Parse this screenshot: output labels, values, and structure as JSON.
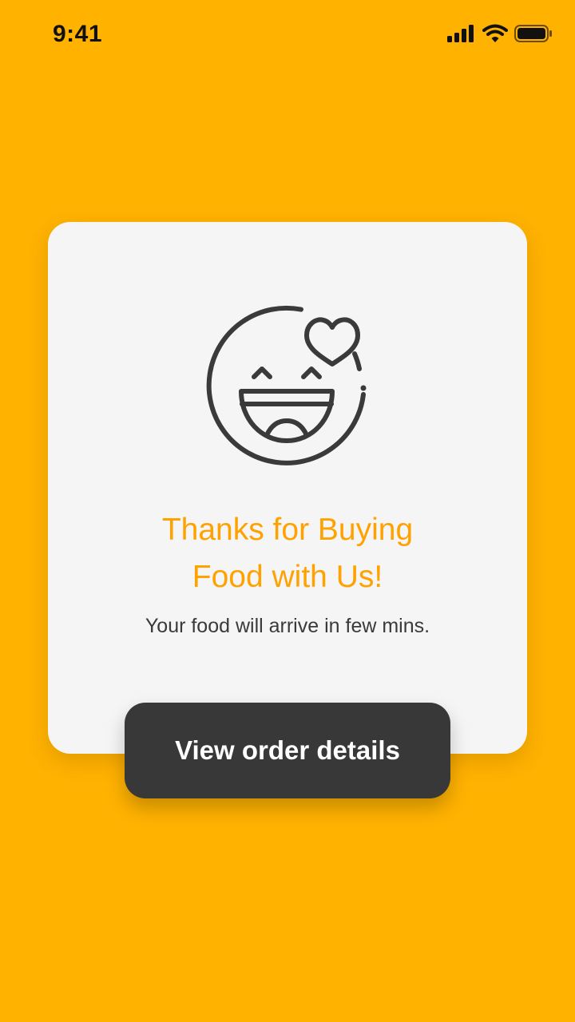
{
  "status_bar": {
    "time": "9:41",
    "icons": [
      "cellular-signal-icon",
      "wifi-icon",
      "battery-icon"
    ]
  },
  "confirmation": {
    "icon": "smiling-face-with-heart-icon",
    "title_lines": [
      "Thanks for Buying",
      "Food with Us!"
    ],
    "subtitle": "Your food will arrive in few mins."
  },
  "actions": {
    "view_details_label": "View order details"
  },
  "colors": {
    "background": "#FFB200",
    "card": "#F5F5F5",
    "title": "#FFA200",
    "button": "#383838",
    "icon_stroke": "#3A3A3A"
  }
}
